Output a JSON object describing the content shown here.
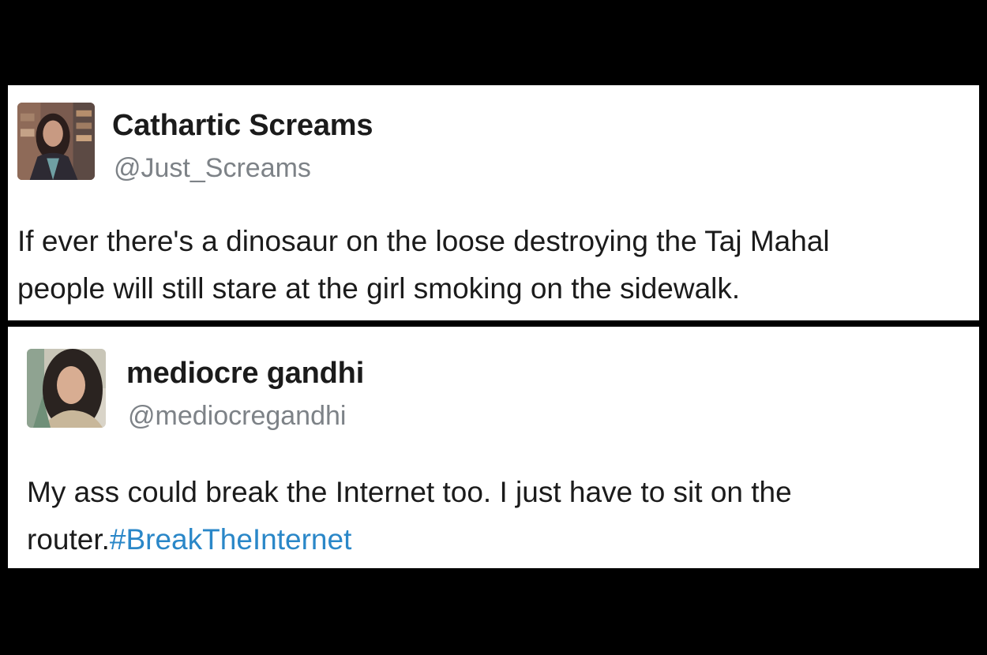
{
  "tweets": [
    {
      "display_name": "Cathartic Screams",
      "handle": "@Just_Screams",
      "text_lines": [
        "If ever there's a dinosaur on the loose destroying the Taj Mahal",
        "people will still stare at the girl smoking on the sidewalk."
      ]
    },
    {
      "display_name": "mediocre gandhi",
      "handle": "@mediocregandhi",
      "text_lines": [
        "My ass could break the Internet too. I just have to sit on the",
        "router."
      ],
      "hashtag": "#BreakTheInternet"
    }
  ],
  "colors": {
    "background": "#000000",
    "card": "#ffffff",
    "name": "#1b1b1b",
    "handle": "#7d8287",
    "hashtag": "#2a87c8"
  }
}
